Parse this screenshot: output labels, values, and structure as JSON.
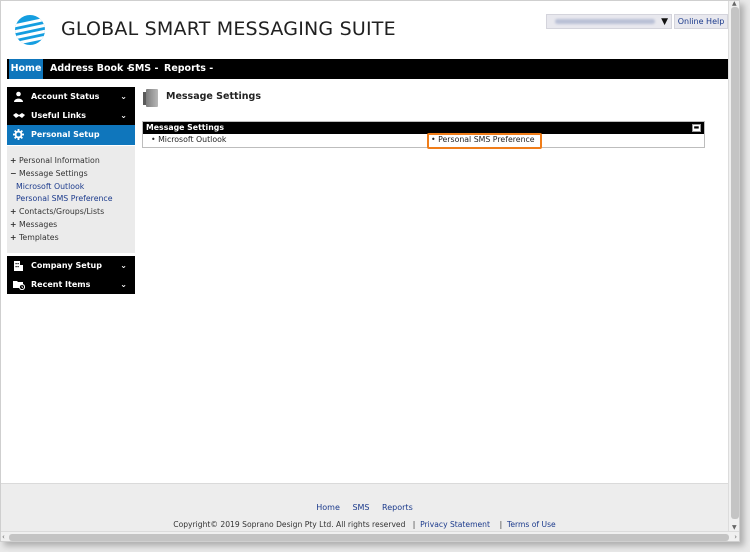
{
  "header": {
    "app_title": "GLOBAL SMART MESSAGING SUITE",
    "user_menu_arrow": "▼",
    "online_help": "Online Help"
  },
  "nav": {
    "home": "Home",
    "address_book": "Address Book -",
    "sms": "SMS -",
    "reports": "Reports -"
  },
  "sidebar": {
    "top_items": [
      {
        "label": "Account Status",
        "icon": "person-icon"
      },
      {
        "label": "Useful Links",
        "icon": "handshake-icon"
      },
      {
        "label": "Personal Setup",
        "icon": "gear-icon"
      }
    ],
    "sub_items": [
      {
        "sign": "+",
        "label": "Personal Information"
      },
      {
        "sign": "−",
        "label": "Message Settings"
      },
      {
        "label": "Microsoft Outlook"
      },
      {
        "label": "Personal SMS Preference"
      },
      {
        "sign": "+",
        "label": "Contacts/Groups/Lists"
      },
      {
        "sign": "+",
        "label": "Messages"
      },
      {
        "sign": "+",
        "label": "Templates"
      }
    ],
    "bottom_items": [
      {
        "label": "Company Setup",
        "icon": "building-icon"
      },
      {
        "label": "Recent Items",
        "icon": "recent-folder-icon"
      }
    ],
    "chevron": "⌄"
  },
  "main": {
    "page_title": "Message Settings",
    "panel": {
      "title": "Message Settings",
      "left_item": "•  Microsoft Outlook",
      "right_item": "•  Personal SMS Preference"
    }
  },
  "footer": {
    "links": [
      "Home",
      "SMS",
      "Reports"
    ],
    "copyright": "Copyright© 2019 Soprano Design Pty Ltd. All rights reserved",
    "separator": "|",
    "privacy": "Privacy Statement",
    "terms": "Terms of Use"
  },
  "colors": {
    "accent": "#0f76bc",
    "nav_bg": "#000000",
    "highlight": "#f07d19",
    "link": "#1b3a8c"
  }
}
